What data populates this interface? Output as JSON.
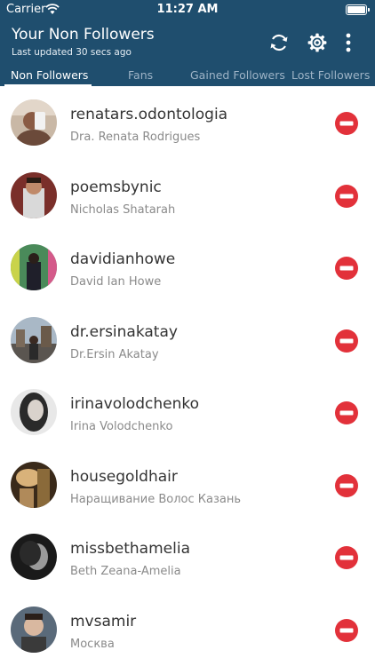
{
  "status_bar": {
    "carrier": "Carrier",
    "time": "11:27 AM"
  },
  "header": {
    "title": "Your Non Followers",
    "subtitle": "Last updated 30 secs ago",
    "icons": [
      "refresh-icon",
      "gear-icon",
      "more-vertical-icon"
    ]
  },
  "tabs": [
    {
      "label": "Non Followers",
      "active": true
    },
    {
      "label": "Fans",
      "active": false
    },
    {
      "label": "Gained Followers",
      "active": false
    },
    {
      "label": "Lost Followers",
      "active": false
    }
  ],
  "users": [
    {
      "username": "renatars.odontologia",
      "name": "Dra. Renata Rodrigues"
    },
    {
      "username": "poemsbynic",
      "name": "Nicholas Shatarah"
    },
    {
      "username": "davidianhowe",
      "name": "David Ian Howe"
    },
    {
      "username": "dr.ersinakatay",
      "name": "Dr.Ersin Akatay"
    },
    {
      "username": "irinavolodchenko",
      "name": "Irina Volodchenko"
    },
    {
      "username": "housegoldhair",
      "name": "Наращивание Волос Казань"
    },
    {
      "username": "missbethamelia",
      "name": "Beth Zeana-Amelia"
    },
    {
      "username": "mvsamir",
      "name": "Москва"
    }
  ],
  "colors": {
    "header_bg": "#1f4e6e",
    "remove_red": "#e2313a"
  }
}
